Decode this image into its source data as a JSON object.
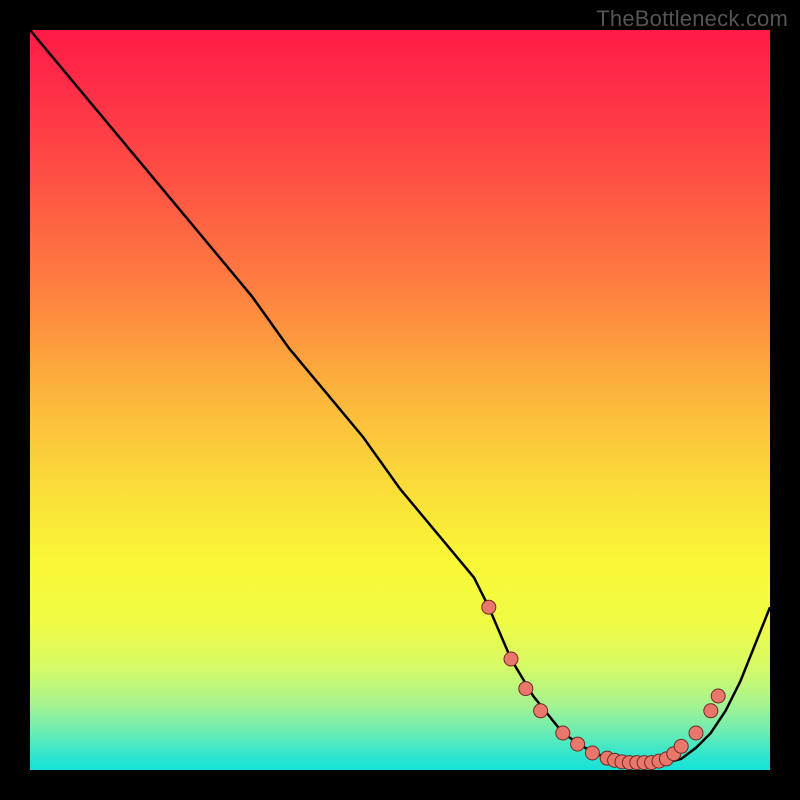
{
  "attribution": "TheBottleneck.com",
  "colors": {
    "frame": "#000000",
    "attribution_text": "#555555",
    "curve_stroke": "#000000",
    "marker_fill": "#E9776B",
    "marker_stroke": "#6F2C24",
    "gradient_stops": [
      {
        "offset": 0.0,
        "color": "#FF1C46"
      },
      {
        "offset": 0.08,
        "color": "#FF2E47"
      },
      {
        "offset": 0.2,
        "color": "#FF5044"
      },
      {
        "offset": 0.35,
        "color": "#FE8040"
      },
      {
        "offset": 0.5,
        "color": "#FCB83C"
      },
      {
        "offset": 0.62,
        "color": "#FBDD39"
      },
      {
        "offset": 0.72,
        "color": "#F9F836"
      },
      {
        "offset": 0.8,
        "color": "#F0FB44"
      },
      {
        "offset": 0.86,
        "color": "#D7FA66"
      },
      {
        "offset": 0.91,
        "color": "#A7F48F"
      },
      {
        "offset": 0.95,
        "color": "#69ECB4"
      },
      {
        "offset": 0.98,
        "color": "#30E5CE"
      },
      {
        "offset": 1.0,
        "color": "#14E2D8"
      }
    ]
  },
  "chart_data": {
    "type": "line",
    "title": "",
    "xlabel": "",
    "ylabel": "",
    "xlim": [
      0,
      100
    ],
    "ylim": [
      0,
      100
    ],
    "grid": false,
    "legend": false,
    "series": [
      {
        "name": "bottleneck-curve",
        "x": [
          0,
          5,
          10,
          15,
          20,
          25,
          30,
          35,
          40,
          45,
          50,
          55,
          60,
          62,
          65,
          68,
          72,
          75,
          78,
          80,
          82,
          84,
          86,
          88,
          90,
          92,
          94,
          96,
          98,
          100
        ],
        "values": [
          100,
          94,
          88,
          82,
          76,
          70,
          64,
          57,
          51,
          45,
          38,
          32,
          26,
          22,
          15,
          10,
          5,
          3,
          1.5,
          1,
          1,
          1,
          1,
          1.5,
          3,
          5,
          8,
          12,
          17,
          22
        ]
      }
    ],
    "markers": {
      "name": "highlight-points",
      "x": [
        62,
        65,
        67,
        69,
        72,
        74,
        76,
        78,
        79,
        80,
        81,
        82,
        83,
        84,
        85,
        86,
        87,
        88,
        90,
        92,
        93
      ],
      "values": [
        22,
        15,
        11,
        8,
        5,
        3.5,
        2.3,
        1.6,
        1.3,
        1.1,
        1,
        1,
        1,
        1,
        1.2,
        1.5,
        2.2,
        3.2,
        5,
        8,
        10
      ]
    }
  }
}
